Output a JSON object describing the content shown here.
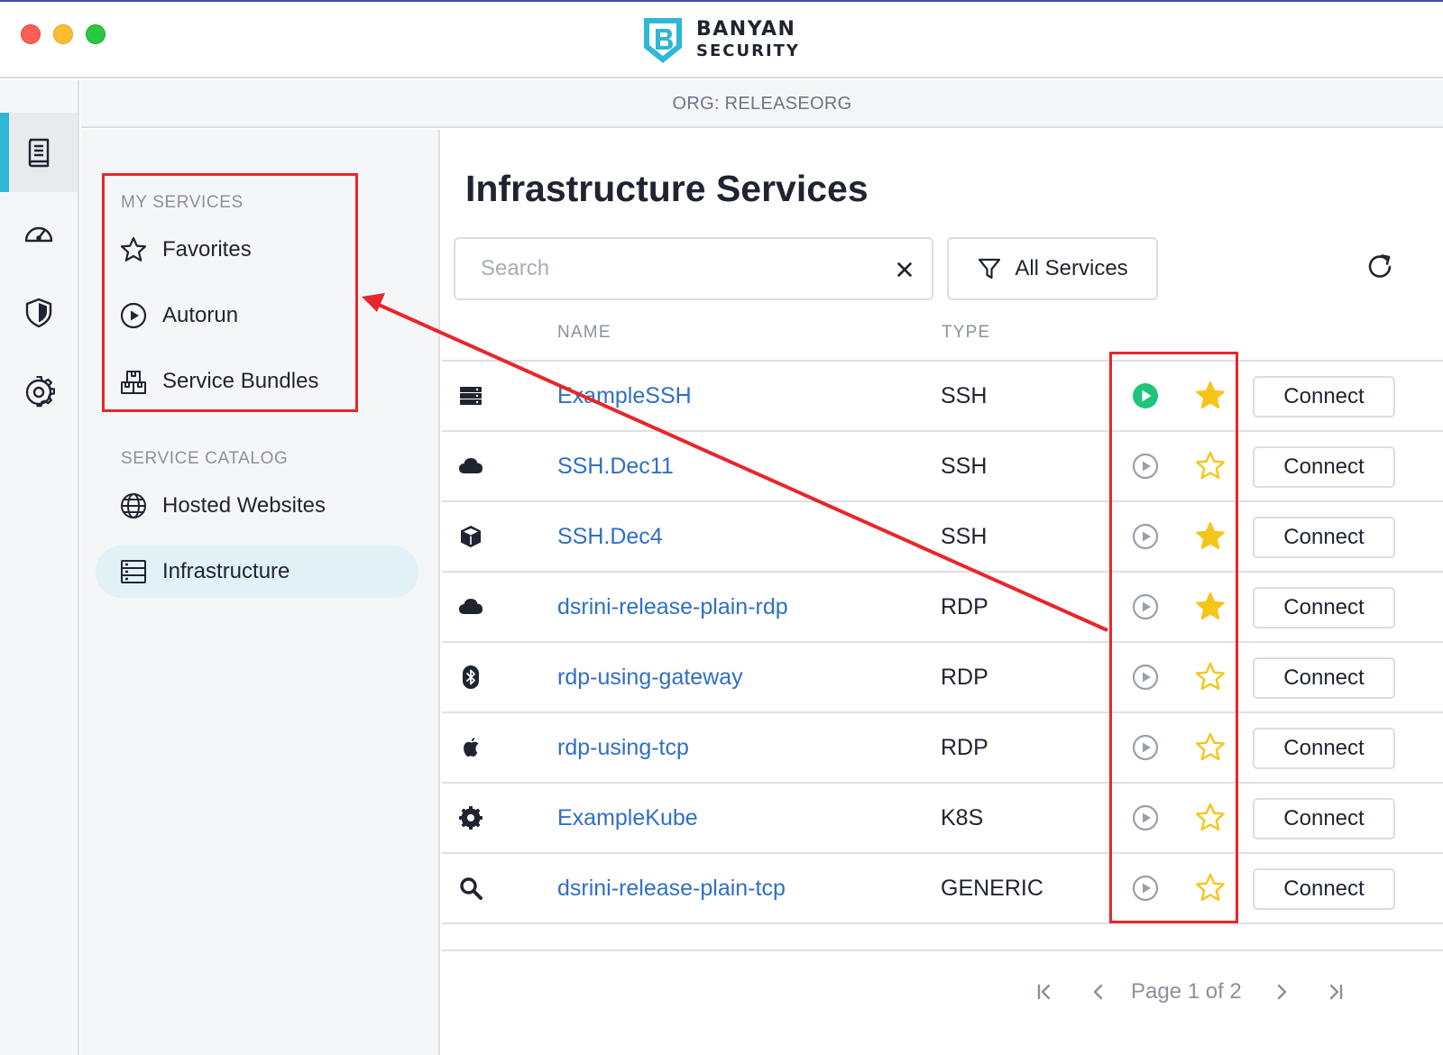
{
  "brand": {
    "line1": "BANYAN",
    "line2": "SECURITY"
  },
  "org": {
    "label": "ORG: RELEASEORG"
  },
  "rail": {
    "items": [
      {
        "name": "book-icon",
        "active": true
      },
      {
        "name": "speedometer-icon",
        "active": false
      },
      {
        "name": "shield-icon",
        "active": false
      },
      {
        "name": "gear-icon",
        "active": false
      }
    ]
  },
  "sidebar": {
    "my_services_label": "MY SERVICES",
    "favorites": "Favorites",
    "autorun": "Autorun",
    "service_bundles": "Service Bundles",
    "catalog_label": "SERVICE CATALOG",
    "hosted_websites": "Hosted Websites",
    "infrastructure": "Infrastructure"
  },
  "main": {
    "title": "Infrastructure Services",
    "search": {
      "placeholder": "Search",
      "value": ""
    },
    "filter_label": "All Services",
    "columns": {
      "name": "NAME",
      "type": "TYPE"
    },
    "connect_label": "Connect",
    "rows": [
      {
        "icon": "server-icon",
        "name": "ExampleSSH",
        "type": "SSH",
        "autorun": true,
        "favorite": true
      },
      {
        "icon": "cloud-icon",
        "name": "SSH.Dec11",
        "type": "SSH",
        "autorun": false,
        "favorite": false
      },
      {
        "icon": "cube-icon",
        "name": "SSH.Dec4",
        "type": "SSH",
        "autorun": false,
        "favorite": true
      },
      {
        "icon": "cloud-icon",
        "name": "dsrini-release-plain-rdp",
        "type": "RDP",
        "autorun": false,
        "favorite": true
      },
      {
        "icon": "bluetooth-icon",
        "name": "rdp-using-gateway",
        "type": "RDP",
        "autorun": false,
        "favorite": false
      },
      {
        "icon": "apple-icon",
        "name": "rdp-using-tcp",
        "type": "RDP",
        "autorun": false,
        "favorite": false
      },
      {
        "icon": "gear-icon",
        "name": "ExampleKube",
        "type": "K8S",
        "autorun": false,
        "favorite": false
      },
      {
        "icon": "search-icon",
        "name": "dsrini-release-plain-tcp",
        "type": "GENERIC",
        "autorun": false,
        "favorite": false
      }
    ],
    "pager": {
      "text": "Page 1 of 2"
    }
  },
  "colors": {
    "accent": "#2fb7d6",
    "link": "#2f6fc4",
    "autorun_active": "#1ec47a",
    "star": "#f5c518",
    "annotation": "#e8262b"
  }
}
